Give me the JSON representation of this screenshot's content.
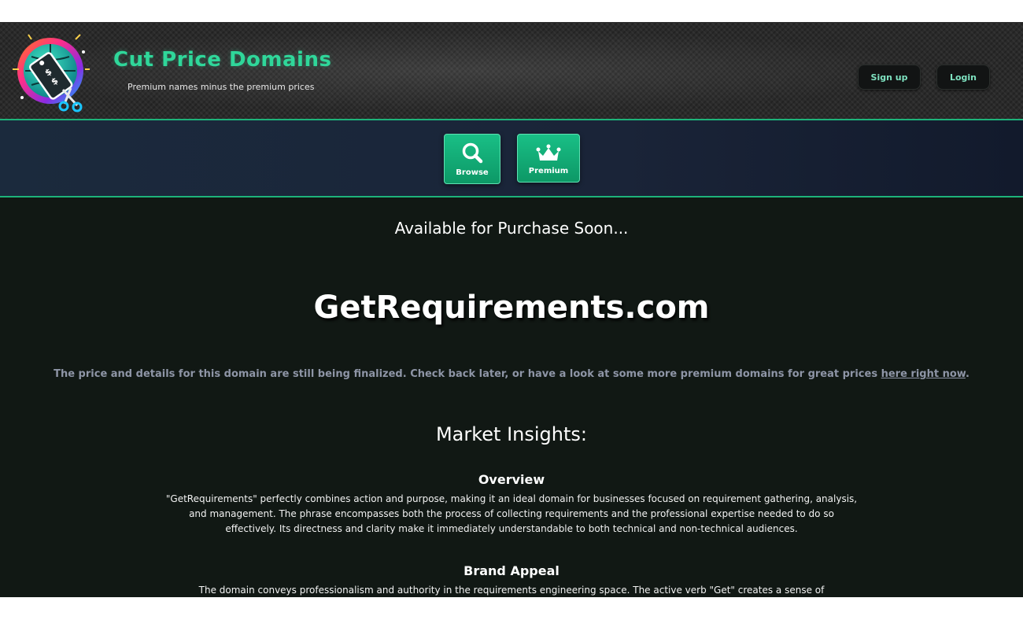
{
  "header": {
    "brand_title": "Cut Price Domains",
    "tagline": "Premium names minus the premium prices",
    "signup_label": "Sign up",
    "login_label": "Login",
    "logo_icon": "globe-price-tag-scissors-logo"
  },
  "nav": {
    "browse_label": "Browse",
    "premium_label": "Premium",
    "browse_icon": "magnifier-icon",
    "premium_icon": "crown-icon"
  },
  "main": {
    "availability": "Available for Purchase Soon...",
    "domain_name": "GetRequirements.com",
    "notice_text": "The price and details for this domain are still being finalized. Check back later, or have a look at some more premium domains for great prices ",
    "notice_link": "here right now",
    "notice_end": ".",
    "insights_title": "Market Insights:",
    "overview": {
      "title": "Overview",
      "text": "\"GetRequirements\" perfectly combines action and purpose, making it an ideal domain for businesses focused on requirement gathering, analysis, and management. The phrase encompasses both the process of collecting requirements and the professional expertise needed to do so effectively. Its directness and clarity make it immediately understandable to both technical and non-technical audiences."
    },
    "brand_appeal": {
      "title": "Brand Appeal",
      "text": "The domain conveys professionalism and authority in the requirements engineering space. The active verb \"Get\" creates a sense of"
    }
  },
  "colors": {
    "accent": "#2fd79a",
    "nav_button": "#19bf86",
    "page_bg": "#111814",
    "muted_text": "#8e95a6"
  }
}
